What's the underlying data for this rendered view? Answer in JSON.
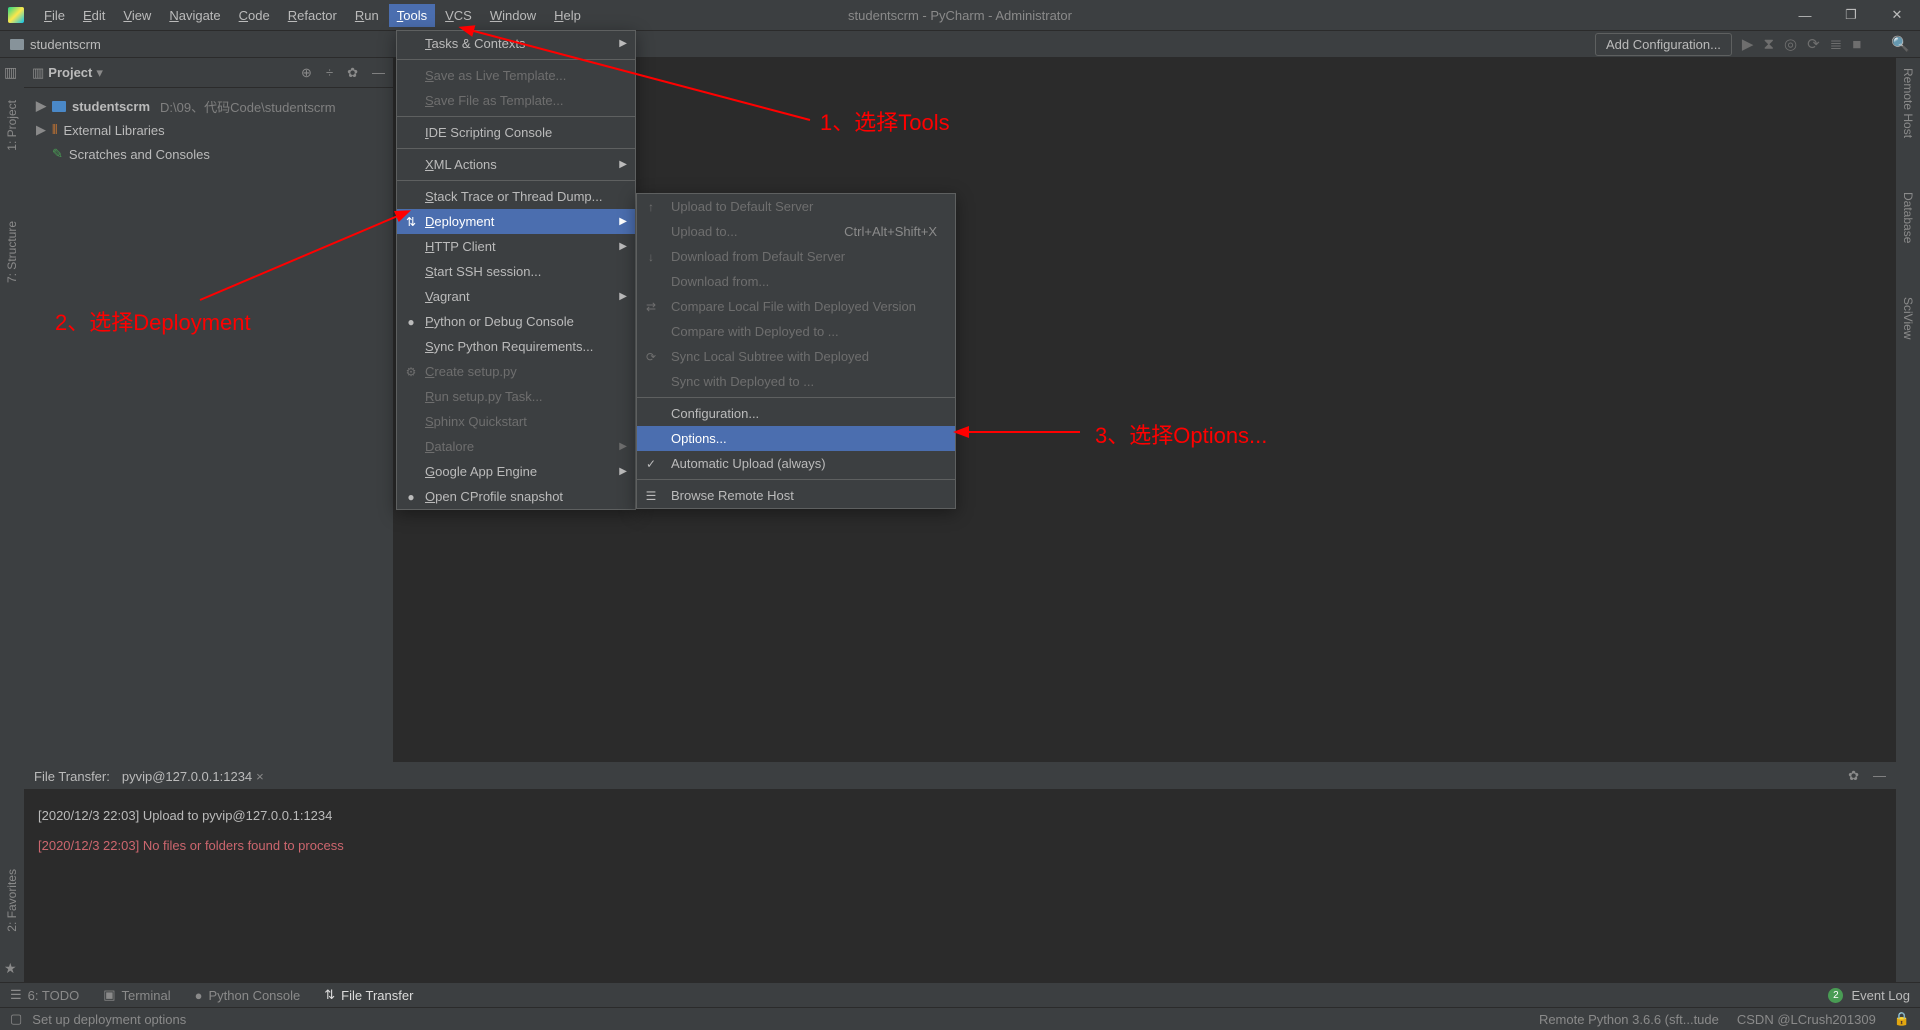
{
  "title": "studentscrm - PyCharm - Administrator",
  "menubar": [
    "File",
    "Edit",
    "View",
    "Navigate",
    "Code",
    "Refactor",
    "Run",
    "Tools",
    "VCS",
    "Window",
    "Help"
  ],
  "menubar_active": "Tools",
  "breadcrumb": "studentscrm",
  "addconf": "Add Configuration...",
  "gutters_left": [
    "1: Project",
    "7: Structure"
  ],
  "gutters_right": [
    "Remote Host",
    "Database",
    "SciView"
  ],
  "sidebar": {
    "title": "Project",
    "rows": [
      {
        "type": "project",
        "label": "studentscrm",
        "path": "D:\\09、代码Code\\studentscrm"
      },
      {
        "type": "libs",
        "label": "External Libraries"
      },
      {
        "type": "scratch",
        "label": "Scratches and Consoles"
      }
    ]
  },
  "tools_menu": [
    {
      "label": "Tasks & Contexts",
      "sub": true
    },
    {
      "sep": true
    },
    {
      "label": "Save as Live Template...",
      "disabled": true
    },
    {
      "label": "Save File as Template...",
      "disabled": true
    },
    {
      "sep": true
    },
    {
      "label": "IDE Scripting Console"
    },
    {
      "sep": true
    },
    {
      "label": "XML Actions",
      "sub": true
    },
    {
      "sep": true
    },
    {
      "label": "Stack Trace or Thread Dump..."
    },
    {
      "label": "Deployment",
      "sub": true,
      "hl": true,
      "icon": "⇅"
    },
    {
      "label": "HTTP Client",
      "sub": true
    },
    {
      "label": "Start SSH session..."
    },
    {
      "label": "Vagrant",
      "sub": true
    },
    {
      "label": "Python or Debug Console",
      "icon": "●"
    },
    {
      "label": "Sync Python Requirements..."
    },
    {
      "label": "Create setup.py",
      "disabled": true,
      "icon": "⚙"
    },
    {
      "label": "Run setup.py Task...",
      "disabled": true
    },
    {
      "label": "Sphinx Quickstart",
      "disabled": true
    },
    {
      "label": "Datalore",
      "disabled": true,
      "sub": true
    },
    {
      "label": "Google App Engine",
      "sub": true
    },
    {
      "label": "Open CProfile snapshot",
      "icon": "●"
    }
  ],
  "deploy_menu": [
    {
      "label": "Upload to Default Server",
      "disabled": true,
      "icon": "↑"
    },
    {
      "label": "Upload to...",
      "disabled": true,
      "shortcut": "Ctrl+Alt+Shift+X"
    },
    {
      "label": "Download from Default Server",
      "disabled": true,
      "icon": "↓"
    },
    {
      "label": "Download from...",
      "disabled": true
    },
    {
      "label": "Compare Local File with Deployed Version",
      "disabled": true,
      "icon": "⇄"
    },
    {
      "label": "Compare with Deployed to ...",
      "disabled": true
    },
    {
      "label": "Sync Local Subtree with Deployed",
      "disabled": true,
      "icon": "⟳"
    },
    {
      "label": "Sync with Deployed to ...",
      "disabled": true
    },
    {
      "sep": true
    },
    {
      "label": "Configuration..."
    },
    {
      "label": "Options...",
      "hl": true
    },
    {
      "label": "Automatic Upload (always)",
      "icon": "✓"
    },
    {
      "sep": true
    },
    {
      "label": "Browse Remote Host",
      "icon": "☰"
    }
  ],
  "file_transfer": {
    "title": "File Transfer:",
    "tab": "pyvip@127.0.0.1:1234",
    "lines": [
      {
        "cls": "l1",
        "text": "[2020/12/3 22:03] Upload to pyvip@127.0.0.1:1234"
      },
      {
        "cls": "l2",
        "text": "[2020/12/3 22:03] No files or folders found to process"
      }
    ]
  },
  "bottom_tabs": [
    {
      "icon": "☰",
      "label": "6: TODO"
    },
    {
      "icon": "▣",
      "label": "Terminal"
    },
    {
      "icon": "●",
      "label": "Python Console"
    },
    {
      "icon": "⇅",
      "label": "File Transfer",
      "active": true
    }
  ],
  "event_log": {
    "badge": "2",
    "label": "Event Log"
  },
  "status": {
    "left": "Set up deployment options",
    "interpreter": "Remote Python 3.6.6 (sft...tude",
    "watermark": "CSDN @LCrush201309"
  },
  "annotations": {
    "a1": "1、选择Tools",
    "a2": "2、选择Deployment",
    "a3": "3、选择Options..."
  }
}
